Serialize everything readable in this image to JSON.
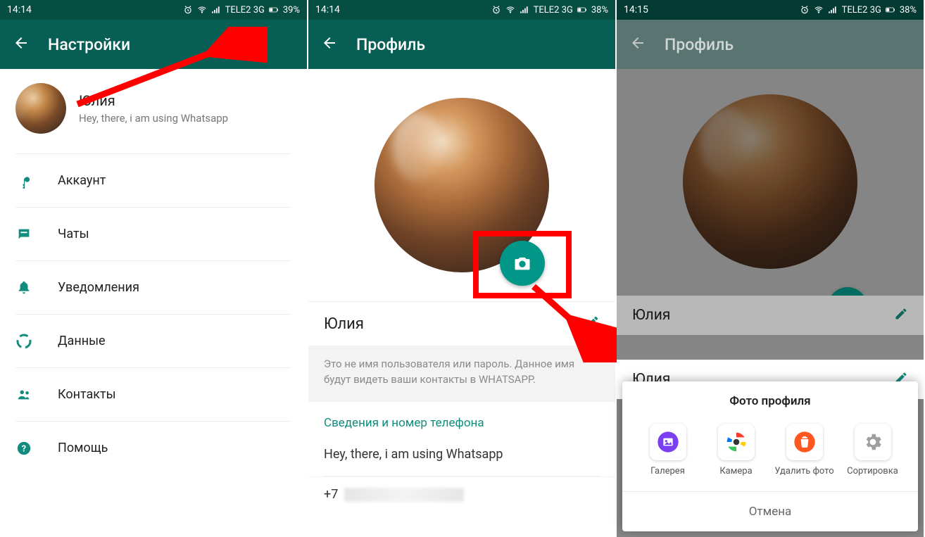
{
  "status": {
    "time1": "14:14",
    "time2": "14:14",
    "time3": "14:15",
    "carrier": "TELE2 3G",
    "battery1": "39%",
    "battery2": "38%",
    "battery3": "38%"
  },
  "screen1": {
    "title": "Настройки",
    "user_name": "Юлия",
    "user_status": "Hey, there, i am using Whatsapp",
    "menu": [
      {
        "label": "Аккаунт",
        "icon": "key-icon"
      },
      {
        "label": "Чаты",
        "icon": "chat-icon"
      },
      {
        "label": "Уведомления",
        "icon": "bell-icon"
      },
      {
        "label": "Данные",
        "icon": "data-icon"
      },
      {
        "label": "Контакты",
        "icon": "contacts-icon"
      },
      {
        "label": "Помощь",
        "icon": "help-icon"
      }
    ]
  },
  "screen2": {
    "title": "Профиль",
    "name": "Юлия",
    "hint": "Это не имя пользователя или пароль. Данное имя будут видеть ваши контакты в WHATSAPP.",
    "section_header": "Сведения и номер телефона",
    "about": "Hey, there, i am using Whatsapp",
    "phone_prefix": "+7"
  },
  "screen3": {
    "title": "Профиль",
    "name": "Юлия",
    "sheet_title": "Фото профиля",
    "options": [
      {
        "label": "Галерея",
        "color": "#7b3ff2"
      },
      {
        "label": "Камера",
        "color": "multicolor"
      },
      {
        "label": "Удалить фото",
        "color": "#ff5722"
      },
      {
        "label": "Сортировка",
        "color": "#9e9e9e"
      }
    ],
    "cancel": "Отмена"
  },
  "colors": {
    "primary": "#075e54",
    "accent": "#128c7e",
    "fab": "#009688",
    "annotation": "#ff0000"
  }
}
